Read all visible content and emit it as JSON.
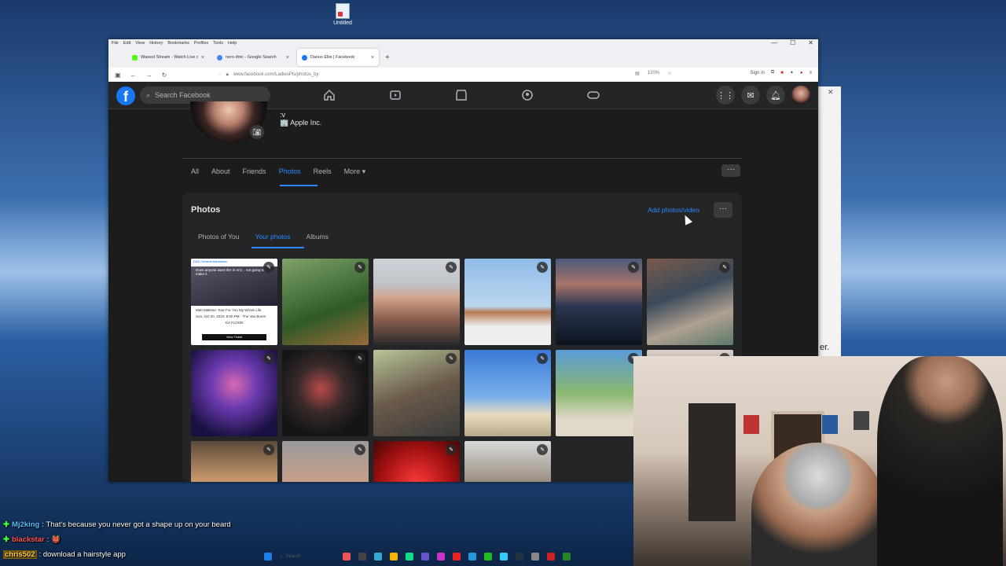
{
  "desktop": {
    "icon_label": "Untitled"
  },
  "background_window": {
    "close": "✕",
    "trailing_text": "er."
  },
  "browser": {
    "menu": [
      "File",
      "Edit",
      "View",
      "History",
      "Bookmarks",
      "Profiles",
      "Tools",
      "Help"
    ],
    "window_controls": {
      "minimize": "—",
      "maximize": "☐",
      "close": "✕"
    },
    "tabs": [
      {
        "label": "Waxest Stream - Watch Live on",
        "fav_color": "#53fc18",
        "active": false
      },
      {
        "label": "nero dmc - Google Search",
        "fav_color": "#4285f4",
        "active": false
      },
      {
        "label": "Darius Ellis | Facebook",
        "fav_color": "#1877f2",
        "active": true
      }
    ],
    "tab_close": "×",
    "new_tab": "+",
    "url": "www.facebook.com/LadiesPls/photos_by",
    "zoom": "120%",
    "sign_in": "Sign in"
  },
  "facebook": {
    "logo": "f",
    "search_placeholder": "Search Facebook",
    "nav_icons": [
      "home-icon",
      "video-icon",
      "marketplace-icon",
      "groups-icon",
      "gaming-icon"
    ],
    "profile": {
      "line1": ":v",
      "line2": "🏢 Apple Inc."
    },
    "profile_tabs": [
      "All",
      "About",
      "Friends",
      "Photos",
      "Reels",
      "More ▾"
    ],
    "active_profile_tab": "Photos",
    "more_dots": "···",
    "photos": {
      "title": "Photos",
      "add_button": "Add photos/video",
      "dots": "···",
      "sub_tabs": [
        "Photos of You",
        "Your photos",
        "Albums"
      ],
      "active_sub_tab": "Your photos",
      "ticket": {
        "header": "DAS     General Admission",
        "headline": "Does anyone want this in Ariz... not going to make it",
        "artist": "Matt Maltese: Tour For You My Whole Life",
        "date": "Sun, Oct 20, 2024, 8:00 PM · The Van Buren",
        "floor": "GA FLOOR",
        "button": "View Ticket"
      },
      "tiles": [
        {
          "c": "linear-gradient(160deg,#7fa36a,#2f5a26 60%,#9a6a3a)"
        },
        {
          "c": "linear-gradient(180deg,#cfd2d8 0,#bfc2c8 30%,#d2a48d 45%,#8a5e4e 70%,#2a2a2a)"
        },
        {
          "c": "linear-gradient(180deg,#8fbbe8 0,#bcd6ef 55%,#b97a55 62%,#eeeeee 78%)"
        },
        {
          "c": "linear-gradient(180deg,#4c5a7a 0,#a8746a 30%,#2a3650 55%,#0d1320)"
        },
        {
          "c": "linear-gradient(160deg,#7a5a4a,#3a4a5a 40%,#b0a090 70%,#5a7a6a)"
        },
        {
          "c": "radial-gradient(circle at 50% 40%,#d86ab0 0,#6a3ab0 35%,#1a1040 80%)"
        },
        {
          "c": "radial-gradient(circle at 45% 45%,#b84a4a 0,#3a2a2a 35%,#151515 70%)"
        },
        {
          "c": "linear-gradient(160deg,#b7c59a,#6a5a4a 50%,#3a3a3a)"
        },
        {
          "c": "linear-gradient(180deg,#3a7ad8 0,#7ab0ea 55%,#e8dcc0 75%,#b8a88a)"
        },
        {
          "c": "linear-gradient(180deg,#5a9ad8 0,#8ab870 50%,#e0d8c8 80%)"
        },
        {
          "c": "linear-gradient(180deg,#d8d0c8,#8a6a5a 50%,#3a2a2a)"
        },
        {
          "c": "linear-gradient(180deg,#5a4a3a,#c8986a 45%,#2a2a2a)"
        },
        {
          "c": "linear-gradient(180deg,#9a9a9a,#caa08a 50%,#3a3a3a)"
        },
        {
          "c": "radial-gradient(circle at 50% 50%,#ff3a3a 0,#a01010 60%,#400808)"
        },
        {
          "c": "linear-gradient(180deg,#d8d8d8,#8a7a6a 60%,#4a4a4a)"
        }
      ],
      "edit_glyph": "✎"
    }
  },
  "chat": [
    {
      "user": "Mj2king",
      "msg": ": That's because you never got a shape up on your beard",
      "style": "user1"
    },
    {
      "user": "blackstar",
      "msg": ": 👹",
      "style": "user2"
    },
    {
      "user": "chris502",
      "msg": ": download a hairstyle app",
      "style": "user3"
    }
  ],
  "taskbar": {
    "search": "Search"
  }
}
